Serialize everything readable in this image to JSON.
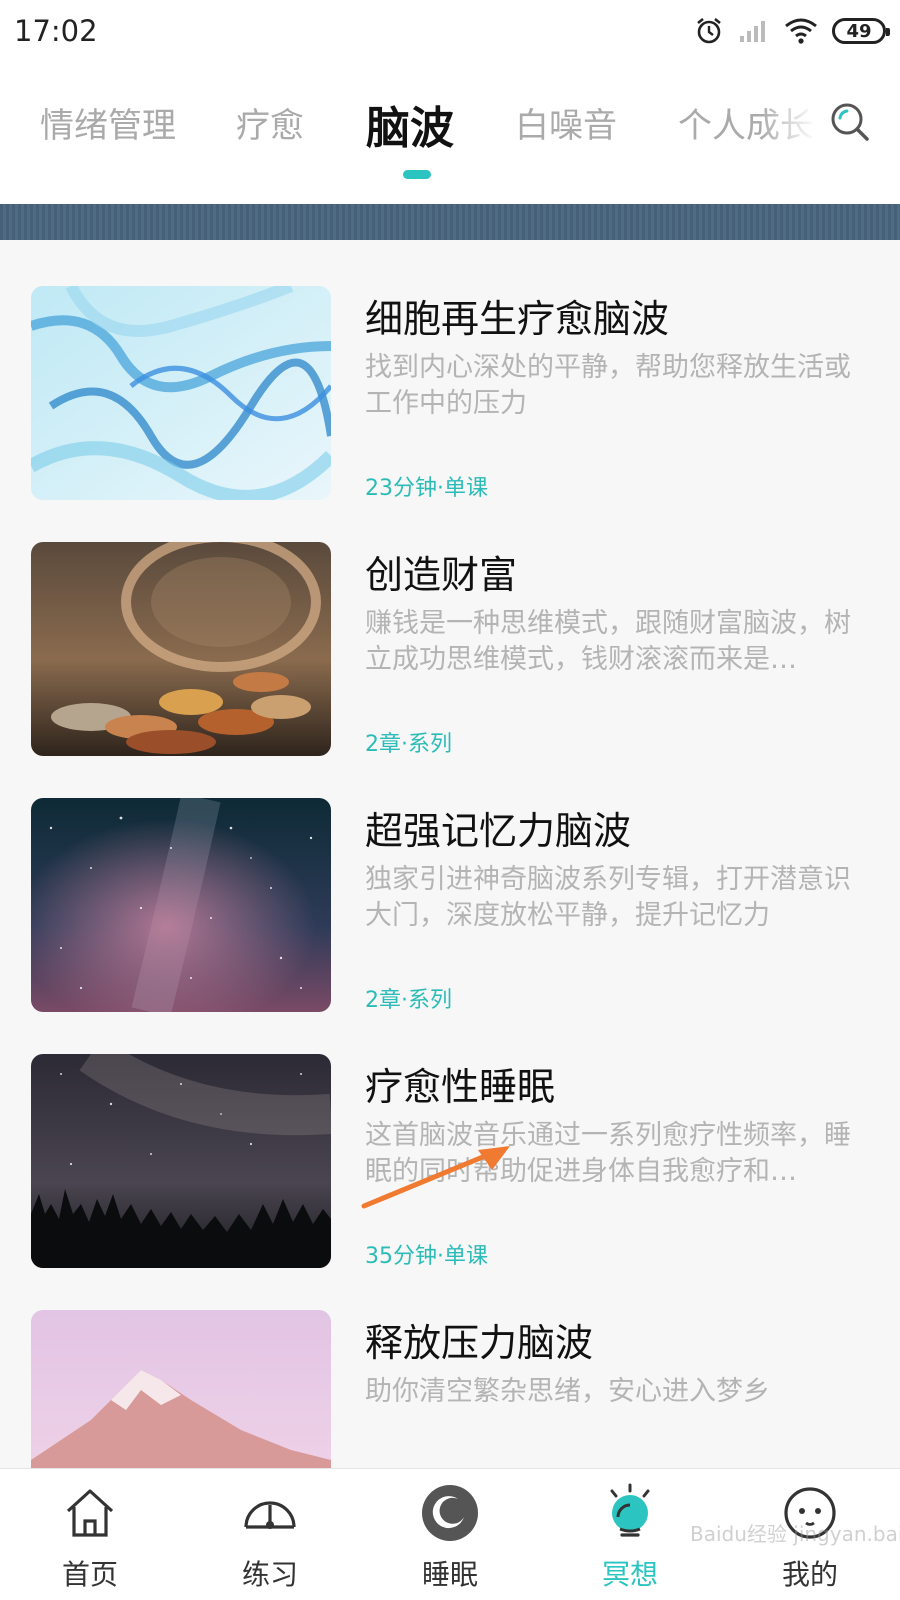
{
  "status_bar": {
    "time": "17:02",
    "battery": "49"
  },
  "tabs": [
    {
      "label": "情绪管理",
      "active": false
    },
    {
      "label": "疗愈",
      "active": false
    },
    {
      "label": "脑波",
      "active": true
    },
    {
      "label": "白噪音",
      "active": false
    },
    {
      "label": "个人成长",
      "active": false
    }
  ],
  "items": [
    {
      "title": "细胞再生疗愈脑波",
      "desc": "找到内心深处的平静，帮助您释放生活或工作中的压力",
      "meta": "23分钟·单课",
      "thumb": "blue-marble-image"
    },
    {
      "title": "创造财富",
      "desc": "赚钱是一种思维模式，跟随财富脑波，树立成功思维模式，钱财滚滚而来是…",
      "meta": "2章·系列",
      "thumb": "coin-jar-image"
    },
    {
      "title": "超强记忆力脑波",
      "desc": "独家引进神奇脑波系列专辑，打开潜意识大门，深度放松平静，提升记忆力",
      "meta": "2章·系列",
      "thumb": "milky-way-image"
    },
    {
      "title": "疗愈性睡眠",
      "desc": "这首脑波音乐通过一系列愈疗性频率，睡眠的同时帮助促进身体自我愈疗和…",
      "meta": "35分钟·单课",
      "thumb": "night-forest-image"
    },
    {
      "title": "释放压力脑波",
      "desc": "助你清空繁杂思绪，安心进入梦乡",
      "meta": "",
      "thumb": "pink-mountain-image"
    }
  ],
  "bottom_nav": [
    {
      "label": "首页",
      "icon": "home-icon",
      "active": false
    },
    {
      "label": "练习",
      "icon": "gauge-icon",
      "active": false
    },
    {
      "label": "睡眠",
      "icon": "moon-icon",
      "active": false
    },
    {
      "label": "冥想",
      "icon": "meditation-icon",
      "active": true
    },
    {
      "label": "我的",
      "icon": "face-icon",
      "active": false
    }
  ],
  "colors": {
    "accent": "#2cc4c0",
    "annotation_arrow": "#f07a30"
  },
  "watermark": "Baidu经验 jingyan.baidu.com"
}
